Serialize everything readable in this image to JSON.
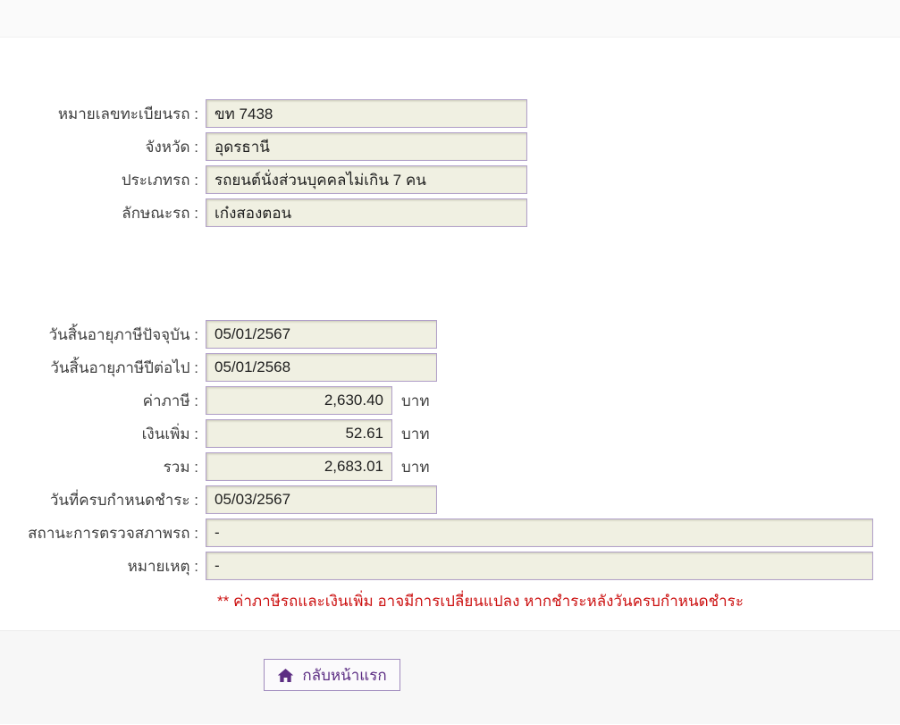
{
  "form": {
    "vehicle": [
      {
        "label": "หมายเลขทะเบียนรถ :",
        "value": "ขท 7438"
      },
      {
        "label": "จังหวัด :",
        "value": "อุดรธานี"
      },
      {
        "label": "ประเภทรถ :",
        "value": "รถยนต์นั่งส่วนบุคคลไม่เกิน 7 คน"
      },
      {
        "label": "ลักษณะรถ :",
        "value": "เก๋งสองตอน"
      }
    ],
    "tax": [
      {
        "label": "วันสิ้นอายุภาษีปัจจุบัน :",
        "value": "05/01/2567"
      },
      {
        "label": "วันสิ้นอายุภาษีปีต่อไป :",
        "value": "05/01/2568"
      },
      {
        "label": "ค่าภาษี :",
        "value": "2,630.40",
        "unit": "บาท"
      },
      {
        "label": "เงินเพิ่ม :",
        "value": "52.61",
        "unit": "บาท"
      },
      {
        "label": "รวม :",
        "value": "2,683.01",
        "unit": "บาท"
      },
      {
        "label": "วันที่ครบกำหนดชำระ :",
        "value": "05/03/2567"
      },
      {
        "label": "สถานะการตรวจสภาพรถ :",
        "value": "-"
      },
      {
        "label": "หมายเหตุ :",
        "value": "-"
      }
    ],
    "warning": "** ค่าภาษีรถและเงินเพิ่ม อาจมีการเปลี่ยนแปลง หากชำระหลังวันครบกำหนดชำระ"
  },
  "footer": {
    "home_button_label": "กลับหน้าแรก"
  },
  "colors": {
    "field_background": "#f0f0e2",
    "field_border": "#b2a1c9",
    "button_text": "#5c2d83",
    "warning_text": "#cc1111",
    "topbar_background": "#fafafa",
    "footer_background": "#f7f7f7"
  }
}
